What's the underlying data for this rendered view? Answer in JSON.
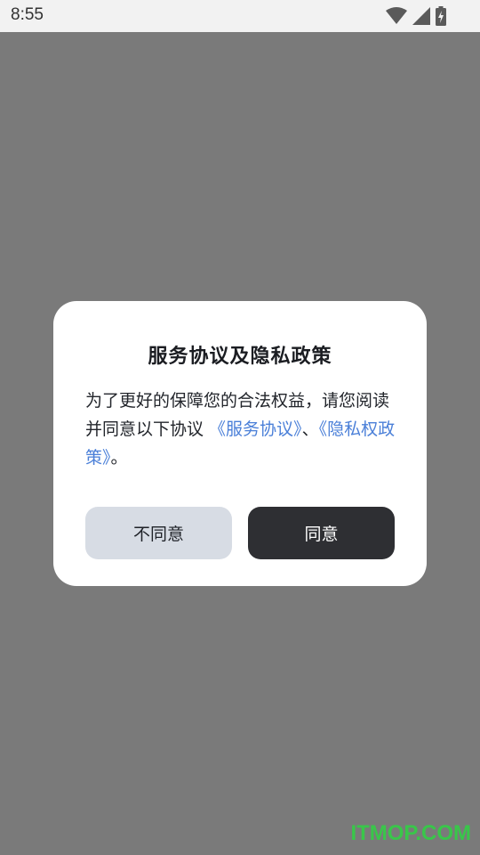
{
  "status_bar": {
    "time": "8:55",
    "icons": [
      "wifi-icon",
      "signal-icon",
      "battery-charging-icon"
    ]
  },
  "dialog": {
    "title": "服务协议及隐私政策",
    "body_prefix": "为了更好的保障您的合法权益，请您阅读并同意以下协议 ",
    "link_service": "《服务协议》",
    "separator": "、",
    "link_privacy": "《隐私权政策》",
    "body_suffix": "。",
    "disagree_label": "不同意",
    "agree_label": "同意"
  },
  "watermark": {
    "text": "ITMOP.COM"
  },
  "colors": {
    "overlay": "#7a7a7a",
    "link": "#4a7fd8",
    "agree_button": "#2e2f33",
    "disagree_button": "#d7dce4",
    "watermark": "#39c64a"
  }
}
